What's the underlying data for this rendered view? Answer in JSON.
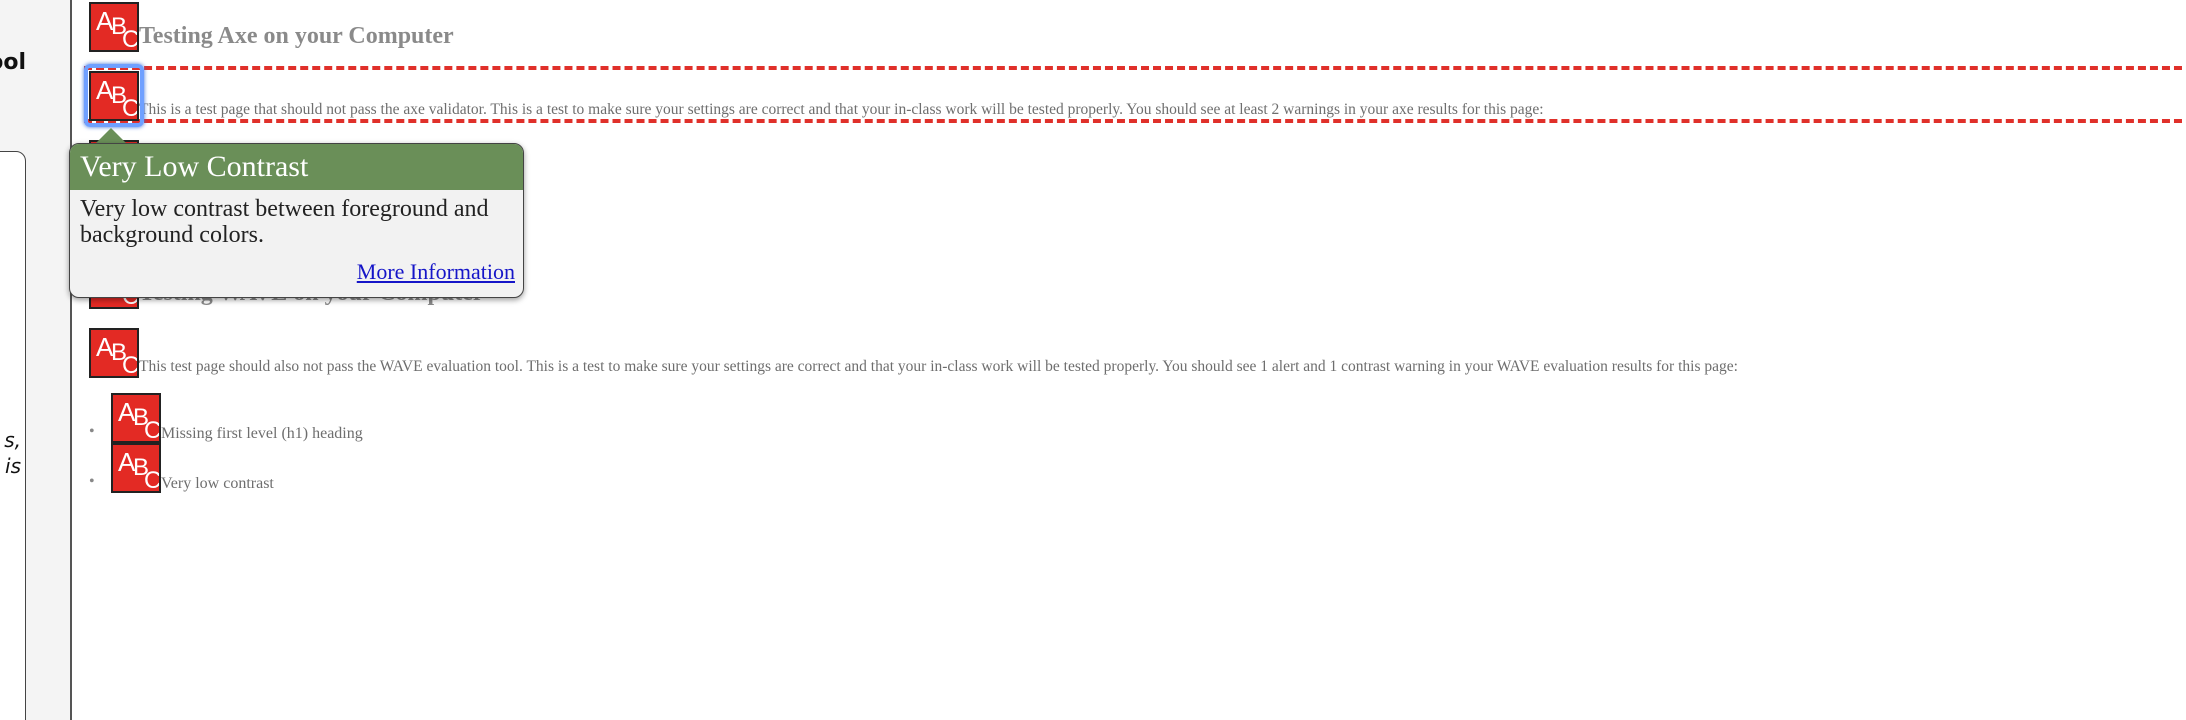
{
  "sidebar": {
    "title_partial": "ool",
    "panel_text_line1": "s,",
    "panel_text_line2": "is"
  },
  "content": {
    "axe_heading": "Testing Axe on your Computer",
    "axe_paragraph": "This is a test page that should not pass the axe validator. This is a test to make sure your settings are correct and that your in-class work will be tested properly. You should see at least 2 warnings in your axe results for this page:",
    "wave_heading": "Testing WAVE on your Computer",
    "wave_paragraph": "This test page should also not pass the WAVE evaluation tool. This is a test to make sure your settings are correct and that your in-class work will be tested properly. You should see 1 alert and 1 contrast warning in your WAVE evaluation results for this page:",
    "wave_list": [
      {
        "bullet": "•",
        "text": "Missing first level (h1) heading"
      },
      {
        "bullet": "•",
        "text": "Very low contrast"
      }
    ]
  },
  "tooltip": {
    "title": "Very Low Contrast",
    "description": "Very low contrast between foreground and background colors.",
    "link": "More Information"
  },
  "icons": {
    "wave_icon": "wave-contrast-error-icon",
    "wave_icon_glyphs": [
      "A",
      "B",
      "C"
    ]
  },
  "colors": {
    "icon_red": "#e32a24",
    "tooltip_header": "#6a8f58",
    "dash_red": "#e0302a",
    "focus_blue": "#6fa0ff",
    "low_contrast_text": "#8a8a8a"
  }
}
